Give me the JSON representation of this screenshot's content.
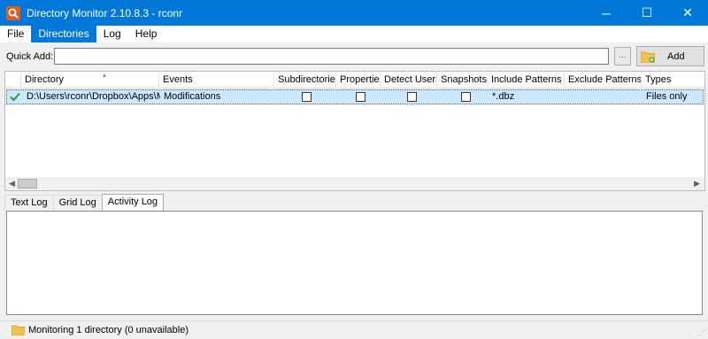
{
  "window": {
    "title": "Directory Monitor 2.10.8.3 - rconr",
    "controls": {
      "minimize": "─",
      "maximize": "☐",
      "close": "✕"
    }
  },
  "menu": [
    "File",
    "Directories",
    "Log",
    "Help"
  ],
  "quick_add": {
    "label": "Quick Add:",
    "value": "",
    "browse_label": "...",
    "add_label": "Add"
  },
  "grid": {
    "columns": [
      "Directory",
      "Events",
      "Subdirectories",
      "Properties",
      "Detect Users",
      "Snapshots",
      "Include Patterns",
      "Exclude Patterns",
      "Types"
    ],
    "rows": [
      {
        "status_icon": "check-icon",
        "directory": "D:\\Users\\rconr\\Dropbox\\Apps\\My...",
        "events": "Modifications",
        "subdirectories": false,
        "properties": false,
        "detect_users": false,
        "snapshots": false,
        "include_patterns": "*.dbz",
        "exclude_patterns": "",
        "types": "Files only"
      }
    ]
  },
  "log_tabs": [
    "Text Log",
    "Grid Log",
    "Activity Log"
  ],
  "status": {
    "text": "Monitoring 1 directory (0 unavailable)"
  },
  "colors": {
    "titlebar": "#0078d7",
    "selected_row": "#cce8ff",
    "app_icon": "#e35b1c",
    "check": "#2e9b2e",
    "folder": "#f2c14e"
  }
}
